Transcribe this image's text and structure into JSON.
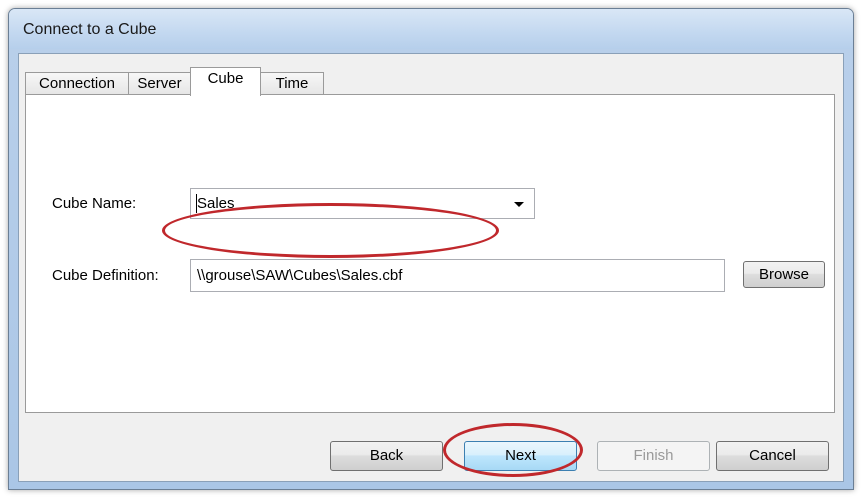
{
  "window": {
    "title": "Connect to a Cube"
  },
  "tabs": [
    {
      "label": "Connection",
      "selected": false
    },
    {
      "label": "Server",
      "selected": false
    },
    {
      "label": "Cube",
      "selected": true
    },
    {
      "label": "Time",
      "selected": false
    }
  ],
  "form": {
    "cube_name_label": "Cube Name:",
    "cube_name_value": "Sales",
    "cube_definition_label": "Cube Definition:",
    "cube_definition_value": "\\\\grouse\\SAW\\Cubes\\Sales.cbf",
    "browse_label": "Browse"
  },
  "buttons": {
    "back": "Back",
    "next": "Next",
    "finish": "Finish",
    "cancel": "Cancel"
  },
  "colors": {
    "annotation": "#c0282c",
    "default_button": "#3c7fb1"
  }
}
